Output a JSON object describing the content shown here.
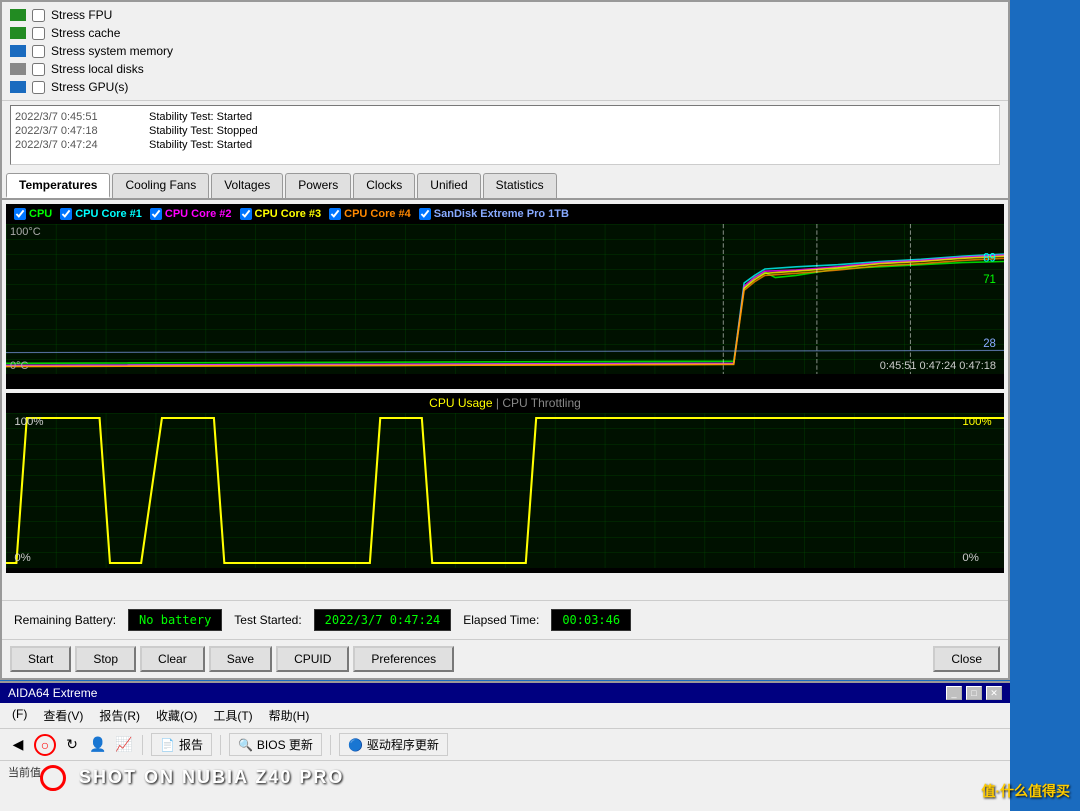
{
  "window": {
    "title": "AIDA64 Extreme",
    "tabs": [
      "Temperatures",
      "Cooling Fans",
      "Voltages",
      "Powers",
      "Clocks",
      "Unified",
      "Statistics"
    ]
  },
  "checklist": {
    "items": [
      {
        "id": "stress-fpu",
        "label": "Stress FPU",
        "checked": false,
        "icon_color": "green"
      },
      {
        "id": "stress-cache",
        "label": "Stress cache",
        "checked": false,
        "icon_color": "green"
      },
      {
        "id": "stress-memory",
        "label": "Stress system memory",
        "checked": false,
        "icon_color": "blue"
      },
      {
        "id": "stress-disks",
        "label": "Stress local disks",
        "checked": false,
        "icon_color": "gray"
      },
      {
        "id": "stress-gpu",
        "label": "Stress GPU(s)",
        "checked": false,
        "icon_color": "blue"
      }
    ]
  },
  "legend": {
    "cpu_label": "CPU",
    "core1_label": "CPU Core #1",
    "core2_label": "CPU Core #2",
    "core3_label": "CPU Core #3",
    "core4_label": "CPU Core #4",
    "sandisk_label": "SanDisk Extreme Pro 1TB"
  },
  "temp_chart": {
    "max_temp": "100°C",
    "min_temp": "0°C",
    "time_labels": "0:45:51  0:47:24  0:47:18",
    "values_right": [
      "89",
      "71",
      "28"
    ]
  },
  "usage_chart": {
    "title_cpu": "CPU Usage",
    "separator": " | ",
    "title_throttle": "CPU Throttling",
    "left_labels": [
      "100%",
      "0%"
    ],
    "right_labels": [
      "100%",
      "0%"
    ]
  },
  "status": {
    "battery_label": "Remaining Battery:",
    "battery_value": "No battery",
    "test_started_label": "Test Started:",
    "test_started_value": "2022/3/7 0:47:24",
    "elapsed_label": "Elapsed Time:",
    "elapsed_value": "00:03:46"
  },
  "buttons": {
    "start": "Start",
    "stop": "Stop",
    "clear": "Clear",
    "save": "Save",
    "cpuid": "CPUID",
    "preferences": "Preferences",
    "close": "Close"
  },
  "log": {
    "rows": [
      {
        "time": "2022/3/7 0:45:51",
        "status": "Stability Test: Started"
      },
      {
        "time": "2022/3/7 0:47:18",
        "status": "Stability Test: Stopped"
      },
      {
        "time": "2022/3/7 0:47:24",
        "status": "Stability Test: Started"
      }
    ]
  },
  "bottom_window": {
    "title": "AIDA64 Extreme",
    "menu": [
      "(F)",
      "查看(V)",
      "报告(R)",
      "收藏(O)",
      "工具(T)",
      "帮助(H)"
    ],
    "toolbar_items": [
      "报告",
      "BIOS 更新",
      "驱动程序更新"
    ],
    "status_text": "当前值"
  },
  "watermark": "SHOT ON NUBIA Z40 PRO",
  "site": "值·什么值得买"
}
